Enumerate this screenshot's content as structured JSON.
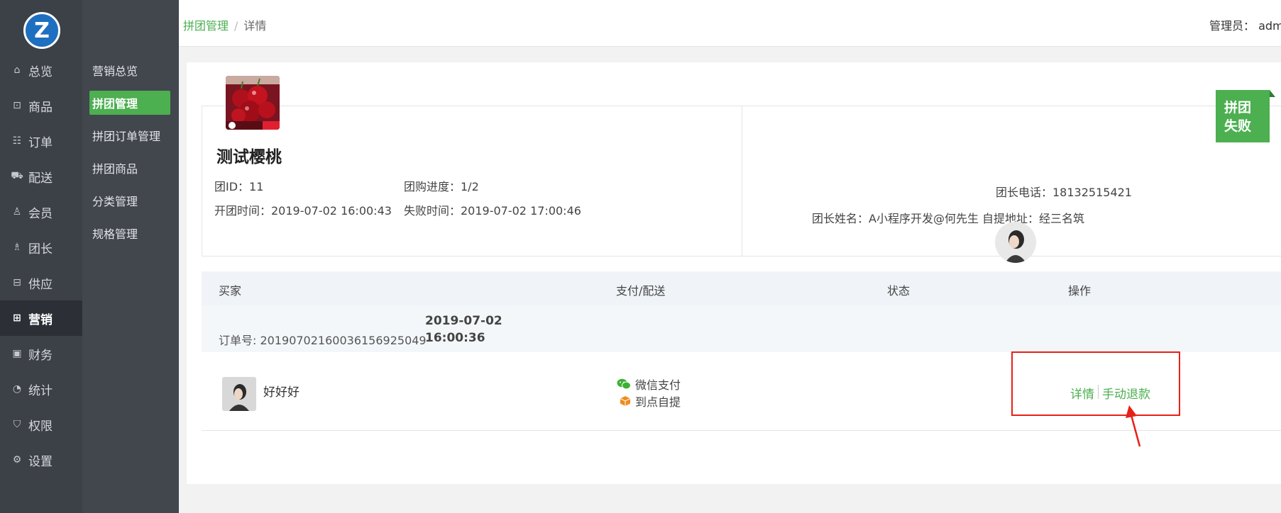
{
  "primary_nav": {
    "items": [
      {
        "label": "总览",
        "icon": "home-icon",
        "glyph": "⌂"
      },
      {
        "label": "商品",
        "icon": "shop-icon",
        "glyph": "⊡"
      },
      {
        "label": "订单",
        "icon": "order-icon",
        "glyph": "☷"
      },
      {
        "label": "配送",
        "icon": "delivery-icon",
        "glyph": "⛟"
      },
      {
        "label": "会员",
        "icon": "member-icon",
        "glyph": "♙"
      },
      {
        "label": "团长",
        "icon": "leader-icon",
        "glyph": "♗"
      },
      {
        "label": "供应",
        "icon": "supply-icon",
        "glyph": "⊟"
      },
      {
        "label": "营销",
        "icon": "gift-icon",
        "glyph": "⊞"
      },
      {
        "label": "财务",
        "icon": "finance-icon",
        "glyph": "▣"
      },
      {
        "label": "统计",
        "icon": "stats-icon",
        "glyph": "◔"
      },
      {
        "label": "权限",
        "icon": "shield-icon",
        "glyph": "⛉"
      },
      {
        "label": "设置",
        "icon": "gear-icon",
        "glyph": "⚙"
      }
    ],
    "active": "营销"
  },
  "secondary_nav": {
    "items": [
      "营销总览",
      "拼团管理",
      "拼团订单管理",
      "拼团商品",
      "分类管理",
      "规格管理"
    ],
    "active": "拼团管理"
  },
  "header": {
    "breadcrumb_parent": "拼团管理",
    "breadcrumb_sep": "/",
    "breadcrumb_current": "详情",
    "admin_text": "管理员： adm"
  },
  "group": {
    "product_title": "测试樱桃",
    "id_label": "团ID：11",
    "progress_label": "团购进度：1/2",
    "open_time_label": "开团时间：2019-07-02 16:00:43",
    "fail_time_label": "失败时间：2019-07-02 17:00:46",
    "leader_phone_label": "团长电话：18132515421",
    "leader_info_label": "团长姓名：A小程序开发@何先生 自提地址：经三名筑",
    "status_line1": "拼团",
    "status_line2": "失败"
  },
  "table": {
    "headers": [
      "买家",
      "支付/配送",
      "状态",
      "操作"
    ],
    "order": {
      "order_no_label": "订单号: 20190702160036156925049",
      "date": "2019-07-02",
      "time": "16:00:36"
    },
    "row": {
      "buyer_name": "好好好",
      "payment": "微信支付",
      "delivery": "到点自提",
      "status": "",
      "action_detail": "详情",
      "action_refund": "手动退款"
    }
  },
  "colors": {
    "accent": "#4caf50",
    "sidebar_primary": "#3c4047",
    "sidebar_secondary": "#42464d",
    "annotation": "#e62117",
    "wechat": "#3cb034",
    "pickup": "#f08b1f"
  }
}
